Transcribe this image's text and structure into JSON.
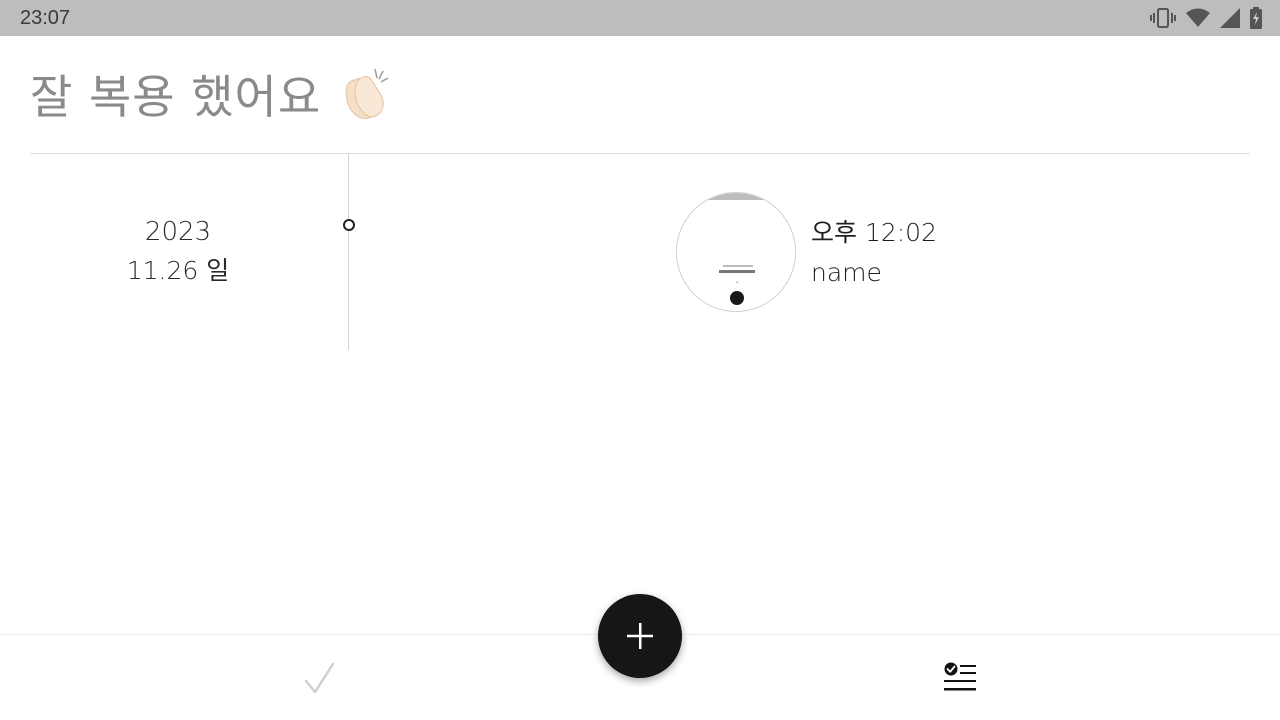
{
  "status_bar": {
    "time": "23:07",
    "icons": [
      "vibrate-icon",
      "wifi-icon",
      "signal-icon",
      "battery-icon"
    ]
  },
  "header": {
    "title": "잘 복용 했어요",
    "emoji_icon": "clapping-hands-icon"
  },
  "timeline": {
    "date": {
      "year": "2023",
      "day": "11.26 일"
    },
    "entries": [
      {
        "time": "오후 12:02",
        "name": "name",
        "thumbnail_icon": "photo-thumbnail"
      }
    ]
  },
  "bottom_nav": {
    "items": [
      {
        "icon": "check-icon",
        "active": false
      },
      {
        "icon": "checklist-icon",
        "active": true
      }
    ],
    "fab_icon": "plus-icon"
  },
  "colors": {
    "status_bar_bg": "#bdbdbd",
    "fab_bg": "#161616",
    "title_text": "#8a8a8a"
  }
}
